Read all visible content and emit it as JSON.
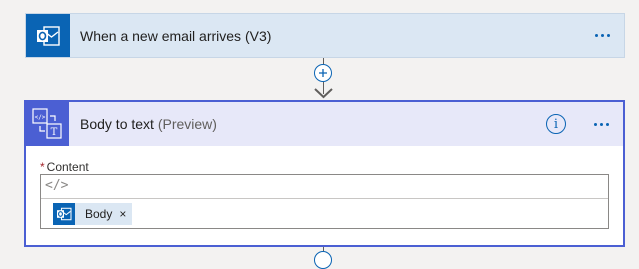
{
  "trigger": {
    "title": "When a new email arrives (V3)",
    "icon": "outlook-icon",
    "more_label": "More options"
  },
  "connector": {
    "add_step_icon": "plus-icon"
  },
  "action": {
    "title": "Body to text",
    "tag": "(Preview)",
    "icon": "html-to-text-icon",
    "info_glyph": "i",
    "field": {
      "required_marker": "*",
      "label": "Content",
      "code_glyph": "</>",
      "token": {
        "label": "Body",
        "remove_glyph": "×",
        "icon": "outlook-icon"
      }
    }
  },
  "colors": {
    "trigger_bg": "#dbe7f3",
    "outlook_blue": "#0a64b4",
    "action_accent": "#4b5fd3",
    "action_header_bg": "#e7e8f9"
  }
}
